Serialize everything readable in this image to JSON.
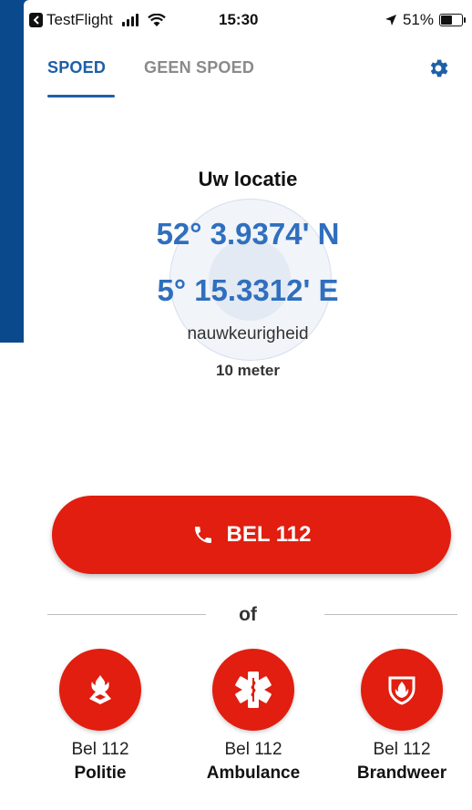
{
  "status_bar": {
    "back_app": "TestFlight",
    "time": "15:30",
    "battery": "51%",
    "battery_level": 0.51
  },
  "tabs": {
    "active": "SPOED",
    "inactive": "GEEN SPOED"
  },
  "location": {
    "title": "Uw locatie",
    "latitude": "52° 3.9374' N",
    "longitude": "5° 15.3312' E",
    "accuracy_label": "nauwkeurigheid",
    "accuracy_value": "10 meter"
  },
  "call_button": {
    "label": "BEL 112"
  },
  "divider_text": "of",
  "services": [
    {
      "line1": "Bel 112",
      "line2": "Politie",
      "icon": "police-icon"
    },
    {
      "line1": "Bel 112",
      "line2": "Ambulance",
      "icon": "ambulance-star-of-life-icon"
    },
    {
      "line1": "Bel 112",
      "line2": "Brandweer",
      "icon": "fire-department-icon"
    }
  ],
  "colors": {
    "accent_blue": "#1d5fa8",
    "coord_blue": "#2f6fbe",
    "emergency_red": "#e11e0f",
    "background_blue": "#0a4a8c"
  }
}
